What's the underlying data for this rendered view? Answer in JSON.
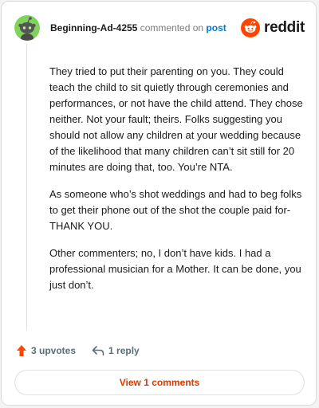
{
  "comment": {
    "username": "Beginning-Ad-4255",
    "commented_text": "commented on",
    "post_link": "post",
    "brand": "reddit",
    "paragraphs": [
      "They tried to put their parenting on you. They could teach the child to sit quietly through ceremonies and performances, or not have the child attend. They chose neither. Not your fault; theirs. Folks suggesting you should not allow any children at your wedding because of the likelihood that many children can’t sit still for 20 minutes are doing that, too. You’re NTA.",
      "As someone who’s shot weddings and had to beg folks to get their phone out of the shot the couple paid for- THANK YOU.",
      "Other commenters; no, I don’t have kids. I had a professional musician for a Mother. It can be done, you just don’t."
    ],
    "upvotes": "3 upvotes",
    "replies": "1 reply",
    "view_comments": "View 1 comments"
  },
  "colors": {
    "reddit_orange": "#ff4500",
    "upvote": "#ff4500",
    "link": "#0079d3",
    "view_button_text": "#d93a00",
    "avatar_bg": "#7fd35a"
  },
  "icons": {
    "avatar": "snoo-avatar-icon",
    "brand": "reddit-logo-icon",
    "upvote": "upvote-arrow-icon",
    "reply": "reply-arrow-icon"
  }
}
